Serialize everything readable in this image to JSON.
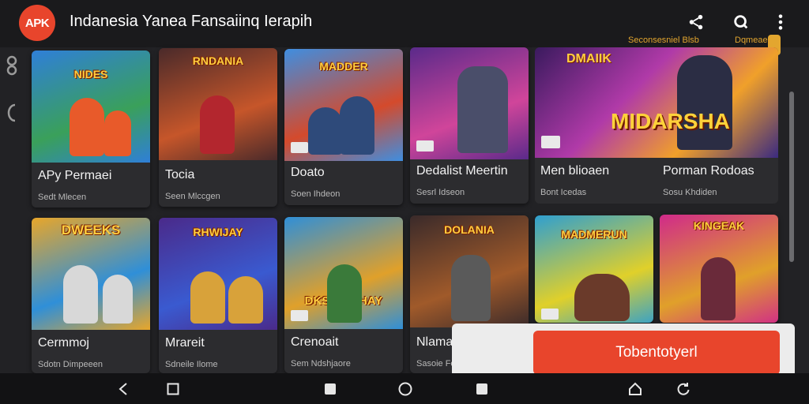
{
  "header": {
    "logo_text": "APK",
    "title": "Indanesia Yanea Fansaiinq Ierapih",
    "sub_left": "Seconsesniel Blsb",
    "sub_right": "Dqmeaegs",
    "icons": [
      "share-icon",
      "search-icon",
      "more-vert-icon"
    ]
  },
  "cards": [
    {
      "art_title": "NIDES",
      "name": "APy Permaei",
      "meta": "Sedt Mlecen",
      "colors": [
        "#2f7fd8",
        "#3aa05a",
        "#e85a2a"
      ]
    },
    {
      "art_title": "RNDANIA",
      "name": "Tocia",
      "meta": "Seen Mlccgen",
      "colors": [
        "#4a2a2a",
        "#c6562a",
        "#b3262e"
      ]
    },
    {
      "art_title": "MADDER",
      "name": "Doato",
      "meta": "Soen Ihdeon",
      "colors": [
        "#3f8ee0",
        "#d44a2c",
        "#2e4a7a"
      ]
    },
    {
      "art_title": "",
      "name": "Dedalist Meertin",
      "meta": "Sesrl Idseon",
      "colors": [
        "#5a2a8a",
        "#d0459a",
        "#4a4e6a"
      ]
    },
    {
      "art_title": "DWEEKS",
      "name": "Cermmoj",
      "meta": "Sdotn Dimpeeen",
      "colors": [
        "#e8a62a",
        "#2f8fd8",
        "#d8d8d8"
      ]
    },
    {
      "art_title": "RHWIJAY",
      "name": "Mrareit",
      "meta": "Sdneile Ilome",
      "colors": [
        "#4a2a8a",
        "#3a5ad0",
        "#d8a23a"
      ]
    },
    {
      "art_title": "DKSRRIRHAY",
      "name": "Crenoait",
      "meta": "Sem Ndshjaore",
      "colors": [
        "#2f8fd8",
        "#e0a02a",
        "#3a7a3a"
      ]
    },
    {
      "art_title": "DOLANIA",
      "name": "Nlamar",
      "meta": "Sasoie Ferthie",
      "colors": [
        "#3a2a2a",
        "#a05a2a",
        "#5a5a5a"
      ]
    },
    {
      "art_title": "MADMERUN",
      "name": "",
      "meta": "",
      "colors": [
        "#2f9fd0",
        "#e0d02a",
        "#6a3a2a"
      ]
    },
    {
      "art_title": "KINGEAK",
      "name": "",
      "meta": "",
      "colors": [
        "#d02a8a",
        "#e0a02a",
        "#6a2a3a"
      ]
    }
  ],
  "featured": {
    "tag": "DMAIIK",
    "title": "MIDARSHA",
    "name_left": "Men blioaen",
    "meta_left": "Bont Icedas",
    "name_right": "Porman Rodoas",
    "meta_right": "Sosu Khdiden"
  },
  "cta_label": "Tobentotyerl",
  "nav": [
    "back-icon",
    "square-icon",
    "recent-icon",
    "home-icon",
    "recent-icon",
    "home-outline-icon",
    "refresh-icon"
  ]
}
